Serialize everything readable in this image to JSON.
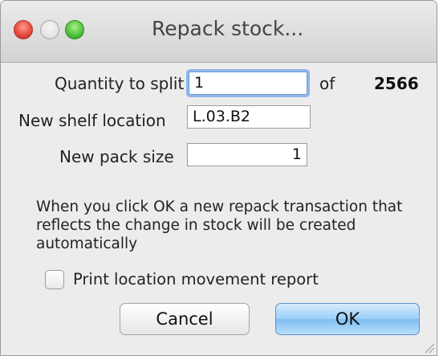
{
  "window": {
    "title": "Repack stock..."
  },
  "form": {
    "quantity_label": "Quantity to split",
    "quantity_value": "1",
    "of_label": "of",
    "quantity_total": "2566",
    "shelf_label": "New shelf location",
    "shelf_value": "L.03.B2",
    "pack_label": "New pack size",
    "pack_value": "1"
  },
  "info_text": "When you click OK a new repack transaction that reflects the change in stock will be created automatically",
  "checkbox": {
    "label": "Print location movement report",
    "checked": false
  },
  "buttons": {
    "cancel": "Cancel",
    "ok": "OK"
  },
  "colors": {
    "ok_button": "#9ccef7",
    "focus_ring": "#8fb6e6",
    "close_light": "#e2463a",
    "zoom_light": "#4dbf36"
  }
}
